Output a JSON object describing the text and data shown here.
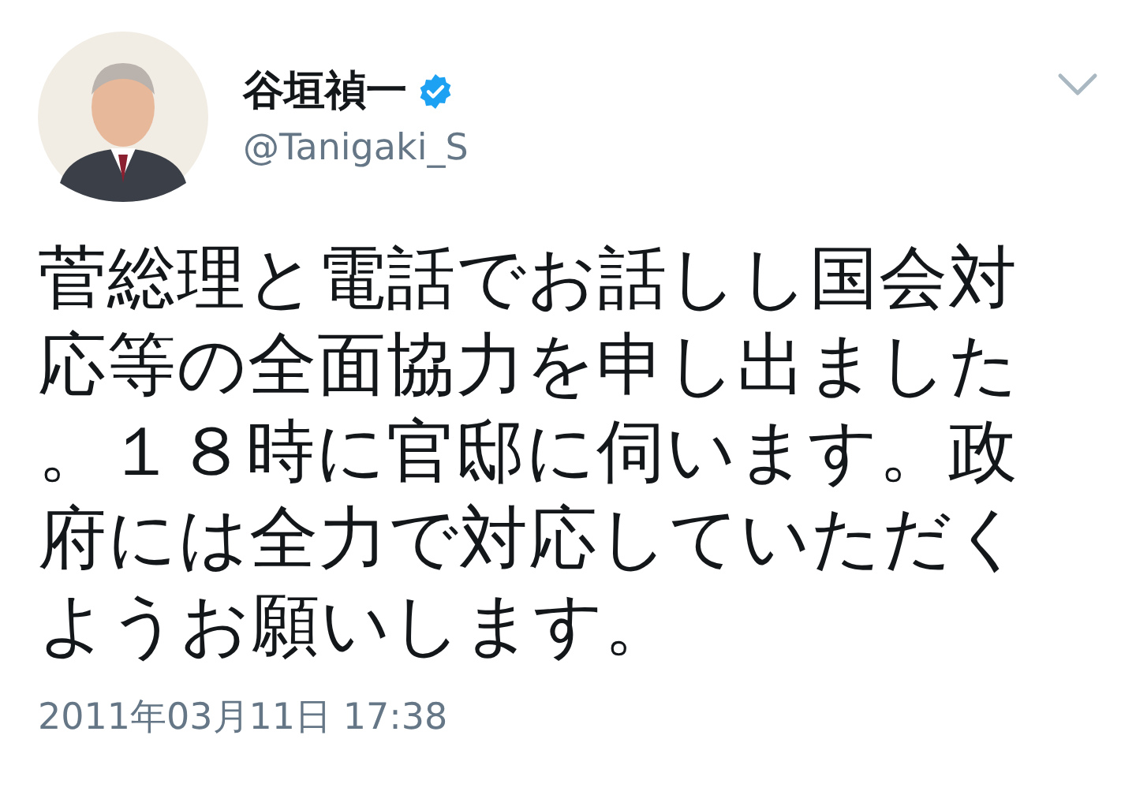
{
  "tweet": {
    "name": "谷垣禎一",
    "verified": true,
    "handle": "@Tanigaki_S",
    "text": "菅総理と電話でお話しし国会対応等の全面協力を申し出ました。１８時に官邸に伺います。政府には全力で対応していただくようお願いします。",
    "timestamp": "2011年03月11日 17:38"
  }
}
